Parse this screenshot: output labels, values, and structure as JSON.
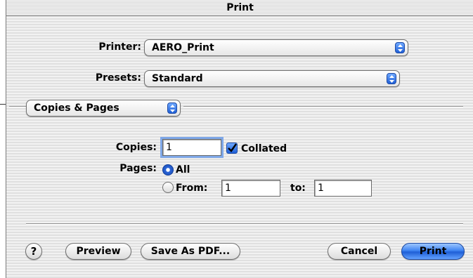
{
  "window": {
    "title": "Print"
  },
  "printer": {
    "label": "Printer:",
    "value": "AERO_Print"
  },
  "presets": {
    "label": "Presets:",
    "value": "Standard"
  },
  "panel": {
    "value": "Copies & Pages"
  },
  "copies": {
    "label": "Copies:",
    "value": "1",
    "collated_label": "Collated",
    "collated_checked": true
  },
  "pages": {
    "label": "Pages:",
    "all_label": "All",
    "from_label": "From:",
    "from_value": "1",
    "to_label": "to:",
    "to_value": "1",
    "selected": "All"
  },
  "buttons": {
    "help": "?",
    "preview": "Preview",
    "save_pdf": "Save As PDF...",
    "cancel": "Cancel",
    "print": "Print"
  },
  "colors": {
    "accent": "#2c66d8",
    "focus_ring": "#7fa8e8"
  },
  "icons": [
    "popup-arrows-icon",
    "checkmark-icon",
    "help-icon"
  ]
}
